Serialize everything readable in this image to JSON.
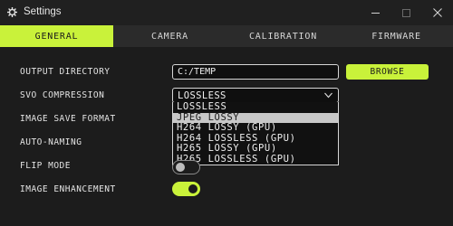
{
  "window": {
    "title": "Settings",
    "icons": [
      "gear-icon",
      "minimize-icon",
      "maximize-icon",
      "close-icon"
    ]
  },
  "tabs": [
    {
      "label": "GENERAL",
      "active": true
    },
    {
      "label": "CAMERA",
      "active": false
    },
    {
      "label": "CALIBRATION",
      "active": false
    },
    {
      "label": "FIRMWARE",
      "active": false
    }
  ],
  "settings": {
    "output_directory": {
      "label": "OUTPUT DIRECTORY",
      "value": "C:/TEMP",
      "button": "BROWSE"
    },
    "svo_compression": {
      "label": "SVO COMPRESSION",
      "selected": "LOSSLESS",
      "options": [
        "LOSSLESS",
        "JPEG LOSSY",
        "H264 LOSSY (GPU)",
        "H264 LOSSLESS (GPU)",
        "H265 LOSSY (GPU)",
        "H265 LOSSLESS (GPU)"
      ],
      "highlighted": "JPEG LOSSY"
    },
    "image_save_format": {
      "label": "IMAGE SAVE FORMAT"
    },
    "auto_naming": {
      "label": "AUTO-NAMING"
    },
    "flip_mode": {
      "label": "FLIP MODE",
      "enabled": false
    },
    "image_enhancement": {
      "label": "IMAGE ENHANCEMENT",
      "enabled": true
    }
  },
  "colors": {
    "accent": "#c9f23a",
    "background": "#1c1c1c",
    "tab_bar": "#2b2b2b"
  }
}
